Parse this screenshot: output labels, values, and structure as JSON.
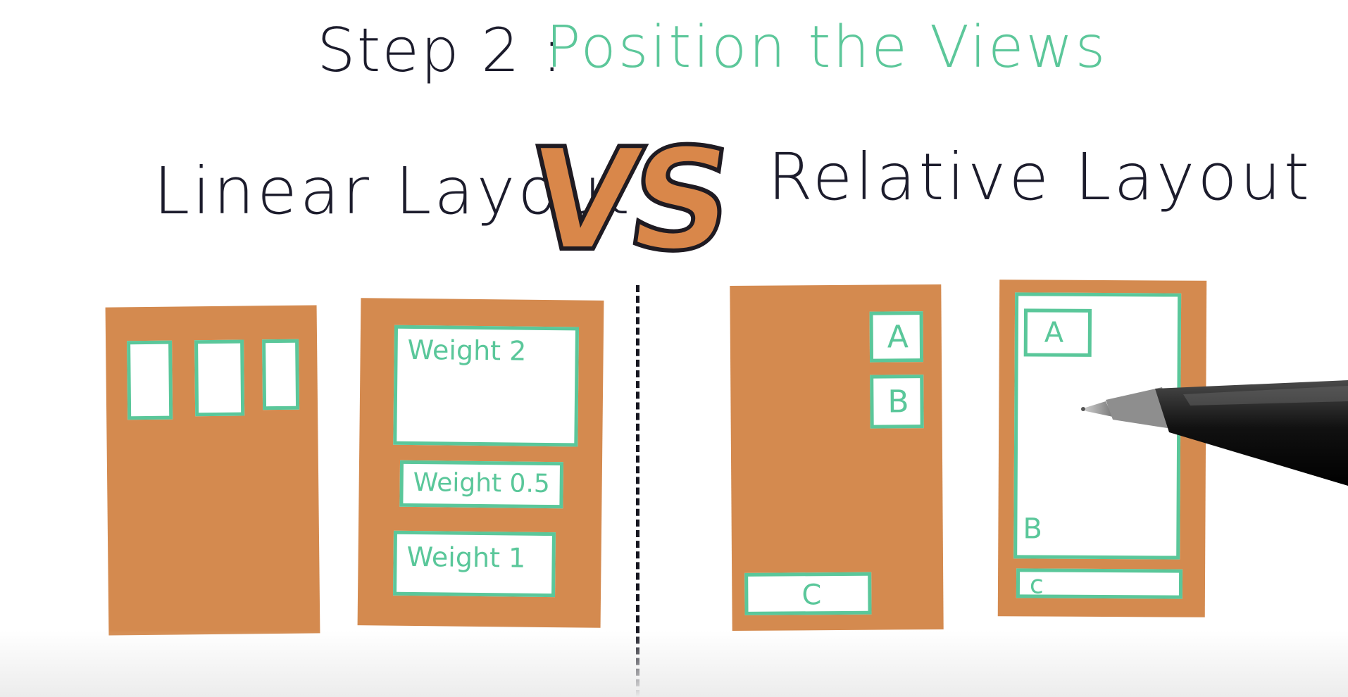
{
  "title": {
    "step_label": "Step 2 :",
    "accent": "Position the Views"
  },
  "comparison": {
    "left": "Linear Layout",
    "vs": "VS",
    "right": "Relative Layout"
  },
  "linear_weight_views": {
    "top": "Weight 2",
    "middle": "Weight 0.5",
    "bottom": "Weight 1"
  },
  "relative_views_first": {
    "a": "A",
    "b": "B",
    "c": "C"
  },
  "relative_views_second": {
    "a": "A",
    "b": "B",
    "c": "c"
  },
  "colors": {
    "panel_orange": "#d48a4f",
    "view_green": "#5ac79a",
    "ink": "#1c1c2c"
  },
  "icons": {
    "pen": "stylus-pen-icon"
  }
}
